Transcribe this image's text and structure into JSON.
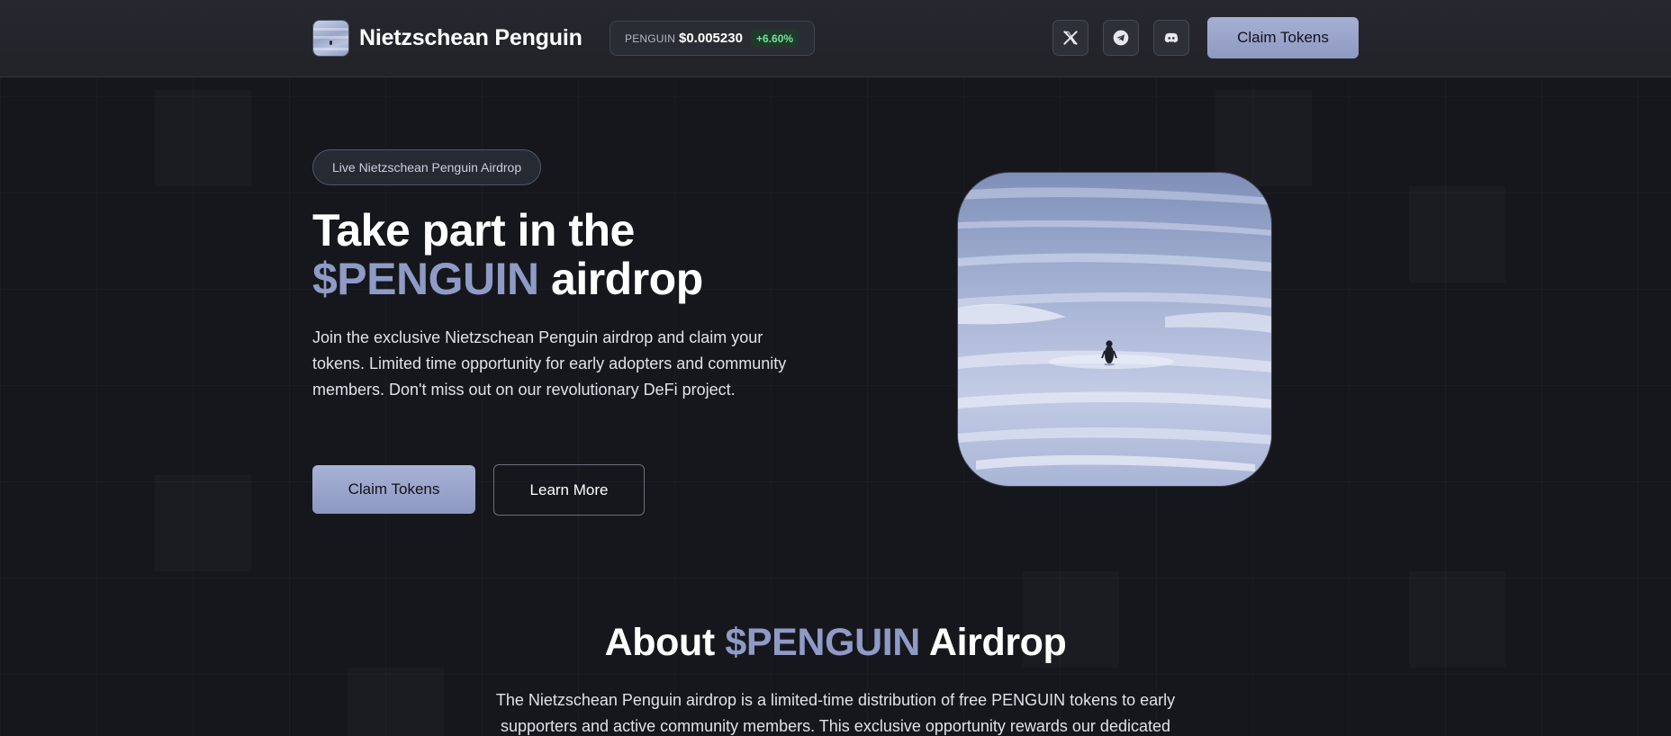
{
  "brand": {
    "name": "Nietzschean Penguin",
    "logo_icon": "penguin-logo"
  },
  "ticker": {
    "symbol": "PENGUIN",
    "price": "$0.005230",
    "change": "+6.60%",
    "change_color": "#6fe39a"
  },
  "social": [
    {
      "name": "x-icon"
    },
    {
      "name": "telegram-icon"
    },
    {
      "name": "discord-icon"
    }
  ],
  "nav": {
    "cta_label": "Claim Tokens"
  },
  "hero": {
    "badge": "Live Nietzschean Penguin Airdrop",
    "headline_line1": "Take part in the",
    "headline_accent": "$PENGUIN",
    "headline_rest": " airdrop",
    "description": "Join the exclusive Nietzschean Penguin airdrop and claim your tokens. Limited time opportunity for early adopters and community members. Don't miss out on our revolutionary DeFi project.",
    "primary_button": "Claim Tokens",
    "secondary_button": "Learn More",
    "image_icon": "penguin-on-ice-image"
  },
  "about": {
    "title_prefix": "About ",
    "title_accent": "$PENGUIN",
    "title_suffix": " Airdrop",
    "text": "The Nietzschean Penguin airdrop is a limited-time distribution of free PENGUIN tokens to early supporters and active community members. This exclusive opportunity rewards our dedicated"
  },
  "colors": {
    "accent": "#8f9bc6",
    "button_bg": "#a6b0d4",
    "page_bg": "#16171c"
  }
}
